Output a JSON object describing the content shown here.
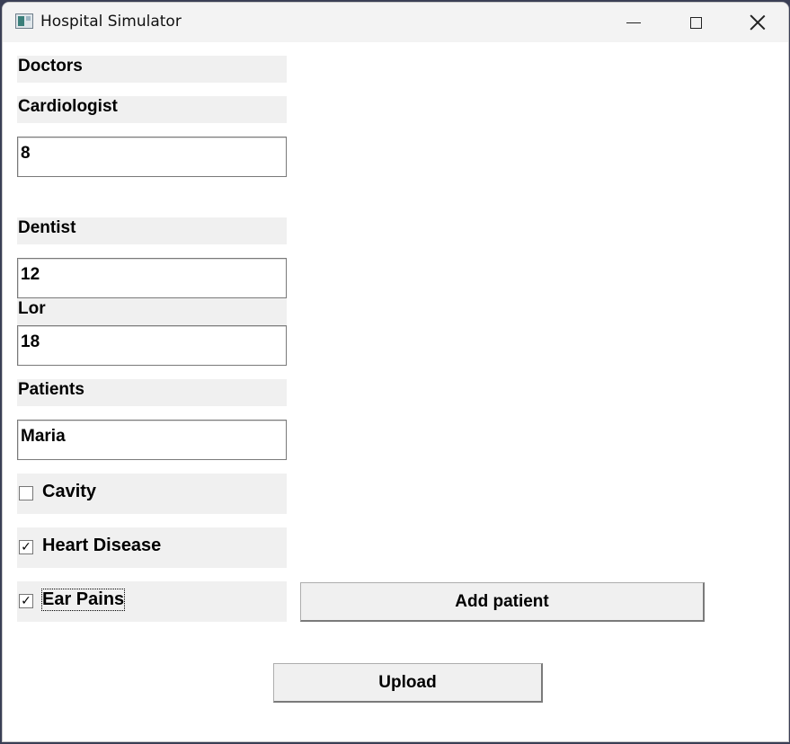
{
  "window": {
    "title": "Hospital Simulator"
  },
  "doctors": {
    "section_label": "Doctors",
    "cardiologist_label": "Cardiologist",
    "cardiologist_value": "8",
    "dentist_label": "Dentist",
    "dentist_value": "12",
    "lor_label": "Lor",
    "lor_value": "18"
  },
  "patients": {
    "section_label": "Patients",
    "name_value": "Maria",
    "conditions": [
      {
        "label": "Cavity",
        "checked": false,
        "mark": ""
      },
      {
        "label": "Heart Disease",
        "checked": true,
        "mark": "✓"
      },
      {
        "label": "Ear Pains",
        "checked": true,
        "mark": "✓"
      }
    ],
    "add_button": "Add patient"
  },
  "upload_button": "Upload"
}
